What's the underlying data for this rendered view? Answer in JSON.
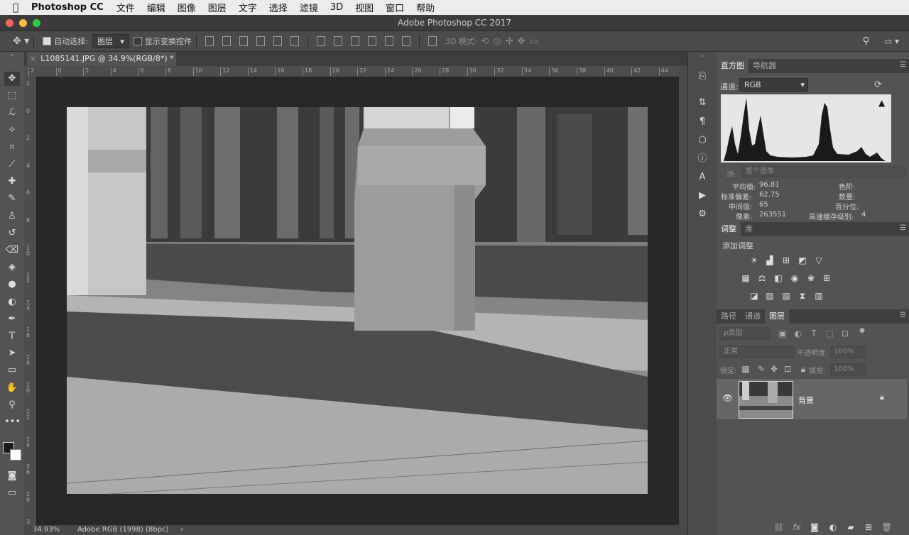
{
  "menubar": {
    "app_name": "Photoshop CC",
    "items": [
      "文件",
      "编辑",
      "图像",
      "图层",
      "文字",
      "选择",
      "滤镜",
      "3D",
      "视图",
      "窗口",
      "帮助"
    ]
  },
  "window": {
    "title": "Adobe Photoshop CC 2017"
  },
  "options_bar": {
    "auto_select_label": "自动选择:",
    "auto_select_value": "图层",
    "show_transform_label": "显示变换控件",
    "mode_3d_label": "3D 模式:"
  },
  "document": {
    "tab_title": "L1085141.JPG @ 34.9%(RGB/8*) *",
    "ruler_h_ticks": [
      "2",
      "0",
      "2",
      "4",
      "6",
      "8",
      "10",
      "12",
      "14",
      "16",
      "18",
      "20",
      "22",
      "24",
      "26",
      "28",
      "30",
      "32",
      "34",
      "36",
      "38",
      "40",
      "42",
      "44"
    ],
    "ruler_v_ticks": [
      "2",
      "0",
      "2",
      "4",
      "6",
      "8",
      "1 0",
      "1 2",
      "1 4",
      "1 6",
      "1 8",
      "2 0",
      "2 2",
      "2 4",
      "2 6",
      "2 8",
      "3"
    ]
  },
  "status": {
    "zoom": "34.93%",
    "profile": "Adobe RGB (1998) (8bpc)",
    "arrow": "›"
  },
  "histogram_panel": {
    "tabs": [
      "直方图",
      "导航器"
    ],
    "channel_label": "通道:",
    "channel_value": "RGB",
    "source_label": "源:",
    "source_value": "整个图像",
    "mean_label": "平均值:",
    "mean_value": "96.81",
    "stddev_label": "标准偏差:",
    "stddev_value": "62.75",
    "median_label": "中间值:",
    "median_value": "65",
    "pixels_label": "像素:",
    "pixels_value": "263551",
    "level_label": "色阶:",
    "count_label": "数量:",
    "percentile_label": "百分位:",
    "cache_label": "高速缓存级别:",
    "cache_value": "4"
  },
  "adjustments_panel": {
    "tabs": [
      "调整",
      "库"
    ],
    "add_label": "添加调整"
  },
  "layers_panel": {
    "tabs": [
      "路径",
      "通道",
      "图层"
    ],
    "filter_label": "ρ类型",
    "blend_mode": "正常",
    "opacity_label": "不透明度:",
    "opacity_value": "100%",
    "lock_label": "锁定:",
    "fill_label": "填充:",
    "fill_value": "100%",
    "layer_name": "背景"
  },
  "colors": {
    "panel_bg": "#535353",
    "canvas_bg": "#282828",
    "menubar_bg": "#ececec"
  }
}
